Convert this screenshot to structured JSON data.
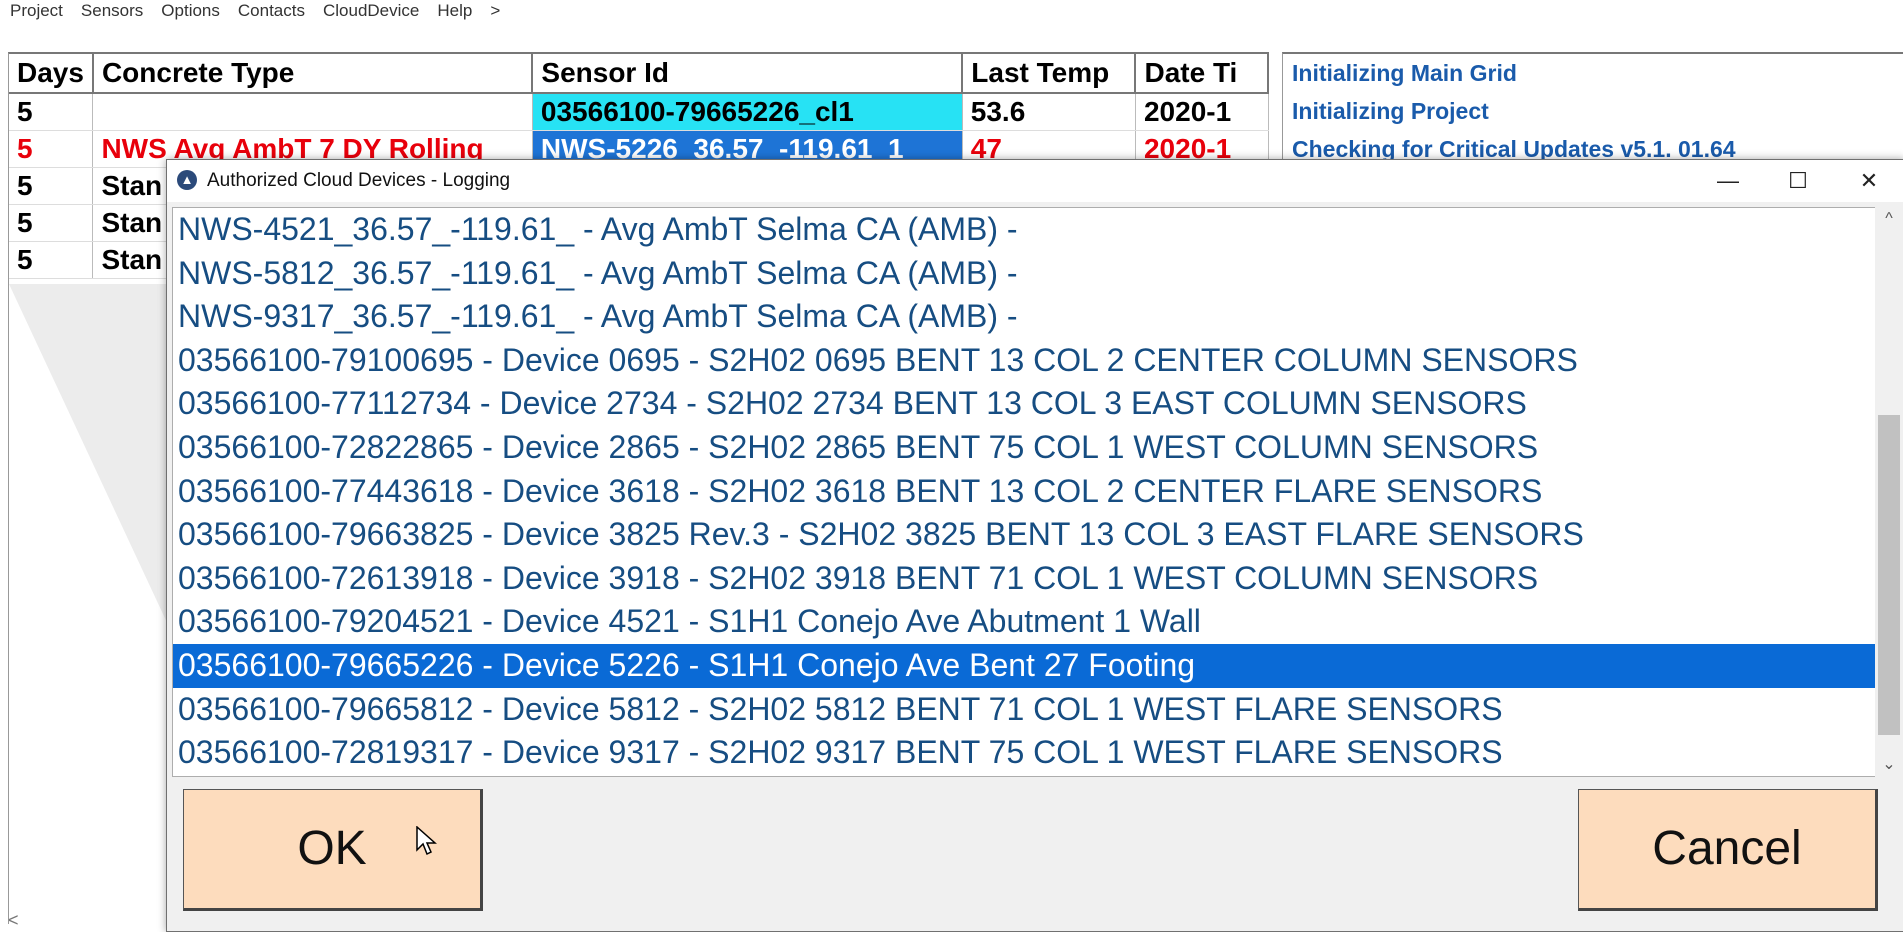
{
  "menu": [
    "Project",
    "Sensors",
    "Options",
    "Contacts",
    "CloudDevice",
    "Help",
    ">"
  ],
  "grid": {
    "headers": [
      "Days",
      "Concrete Type",
      "Sensor Id",
      "Last Temp",
      "Date Ti"
    ],
    "rows": [
      {
        "days": "5",
        "type": "",
        "sensor": "03566100-79665226_cl1",
        "temp": "53.6",
        "date": "2020-1"
      },
      {
        "days": "5",
        "type": "NWS Avg AmbT 7 DY Rolling",
        "sensor": "NWS-5226_36.57_-119.61_1",
        "temp": "47",
        "date": "2020-1"
      },
      {
        "days": "5",
        "type": "Stan",
        "sensor": "",
        "temp": "",
        "date": ""
      },
      {
        "days": "5",
        "type": "Stan",
        "sensor": "",
        "temp": "",
        "date": ""
      },
      {
        "days": "5",
        "type": "Stan",
        "sensor": "",
        "temp": "",
        "date": ""
      }
    ]
  },
  "log": [
    "Initializing Main Grid",
    "Initializing Project",
    "Checking for Critical Updates v5.1.  01.64"
  ],
  "dialog": {
    "title": "Authorized Cloud Devices - Logging",
    "minimize_glyph": "—",
    "maximize_glyph": "☐",
    "close_glyph": "✕",
    "items": [
      "NWS-4521_36.57_-119.61_ - Avg AmbT Selma CA (AMB) -",
      "NWS-5812_36.57_-119.61_ - Avg AmbT Selma CA (AMB) -",
      "NWS-9317_36.57_-119.61_ - Avg AmbT Selma CA (AMB) -",
      "03566100-79100695 - Device 0695 - S2H02 0695 BENT 13 COL 2 CENTER COLUMN SENSORS",
      "03566100-77112734 - Device 2734 - S2H02 2734 BENT 13 COL 3 EAST COLUMN SENSORS",
      "03566100-72822865 - Device 2865 - S2H02 2865 BENT 75 COL 1 WEST COLUMN SENSORS",
      "03566100-77443618 - Device 3618 - S2H02 3618 BENT 13 COL 2 CENTER FLARE SENSORS",
      "03566100-79663825 - Device 3825 Rev.3 - S2H02 3825 BENT 13 COL 3 EAST FLARE SENSORS",
      "03566100-72613918 - Device 3918 - S2H02 3918 BENT 71 COL 1 WEST COLUMN SENSORS",
      "03566100-79204521 - Device 4521 - S1H1 Conejo Ave Abutment 1 Wall",
      "03566100-79665226 - Device 5226 - S1H1 Conejo Ave Bent 27 Footing",
      "03566100-79665812 - Device 5812 - S2H02 5812 BENT 71 COL 1 WEST FLARE SENSORS",
      "03566100-72819317 - Device 9317 - S2H02 9317 BENT 75 COL 1 WEST FLARE SENSORS"
    ],
    "selected_index": 10,
    "ok_label": "OK",
    "cancel_label": "Cancel"
  },
  "colors": {
    "selection": "#0a6ad6",
    "button_bg": "#fddcbd",
    "cyan_cell": "#27e2f4",
    "alert_red": "#e8000b",
    "log_blue": "#1a5bab"
  }
}
